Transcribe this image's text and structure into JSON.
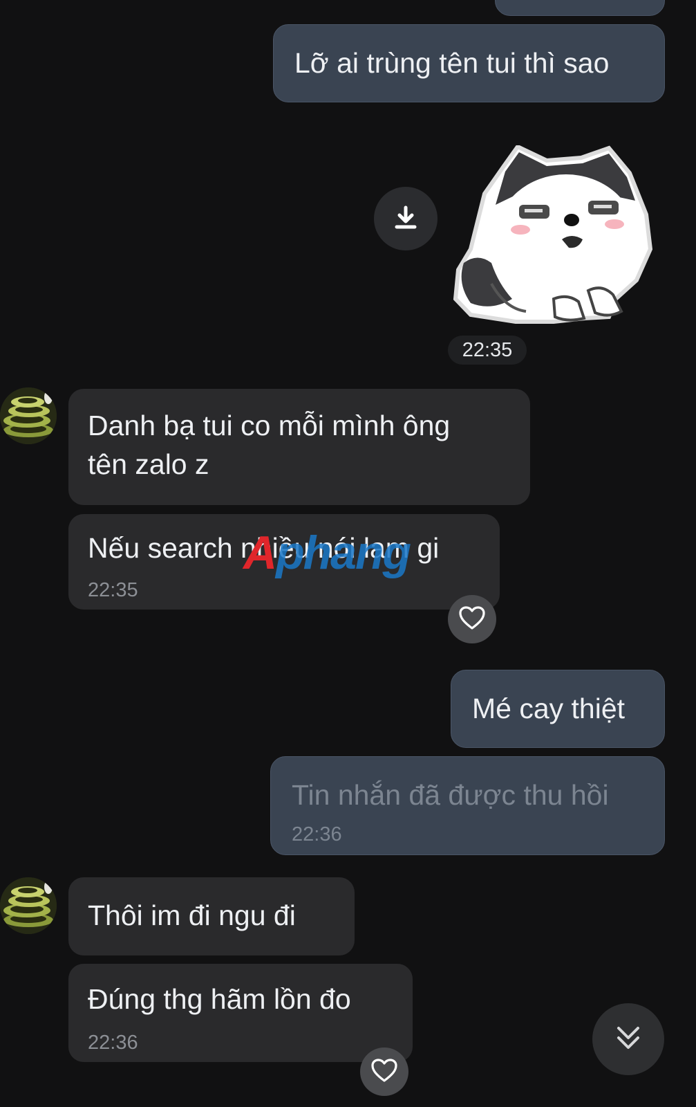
{
  "messages": {
    "m1": {
      "text": "Lỡ ai trùng tên tui thì sao"
    },
    "sticker_time": "22:35",
    "m2": {
      "line1": " Danh bạ tui co mỗi mình ông",
      "line2": "tên zalo z"
    },
    "m3": {
      "text": "Nếu search nhiều nói lam gi",
      "time": "22:35"
    },
    "m4": {
      "text": "Mé cay thiệt"
    },
    "m5": {
      "text": "Tin nhắn đã được thu hồi",
      "time": "22:36"
    },
    "m6": {
      "text": "Thôi im đi ngu đi"
    },
    "m7": {
      "text": "Đúng thg hãm lồn đo",
      "time": "22:36"
    }
  },
  "watermark": {
    "part1": "A",
    "part2": "phang"
  },
  "colors": {
    "background": "#111112",
    "my_bubble": "#3a4452",
    "their_bubble": "#2a2a2c",
    "time_text": "#8c8f95"
  },
  "icons": [
    "download-icon",
    "heart-icon",
    "chevron-double-down-icon",
    "avatar-image",
    "husky-sticker"
  ]
}
